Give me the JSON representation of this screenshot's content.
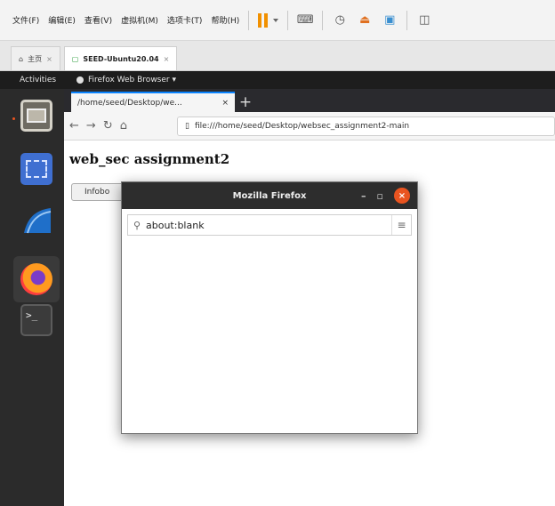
{
  "vm_menu": {
    "items": [
      "文件(F)",
      "编辑(E)",
      "查看(V)",
      "虚拟机(M)",
      "选项卡(T)",
      "帮助(H)"
    ]
  },
  "vm_tabs": [
    {
      "label": "主页"
    },
    {
      "label": "SEED-Ubuntu20.04"
    }
  ],
  "ubuntu": {
    "activities": "Activities",
    "app_name": "Firefox Web Browser ▾"
  },
  "firefox": {
    "tab_title": "/home/seed/Desktop/we...",
    "new_tab": "+",
    "url": "file:///home/seed/Desktop/websec_assignment2-main",
    "page_title": "web_sec assignment2",
    "button_label": "Infobo"
  },
  "popup": {
    "title": "Mozilla Firefox",
    "url": "about:blank"
  },
  "colors": {
    "accent": "#e95420",
    "vm_pause": "#f19000",
    "tab_highlight": "#0a84ff"
  }
}
